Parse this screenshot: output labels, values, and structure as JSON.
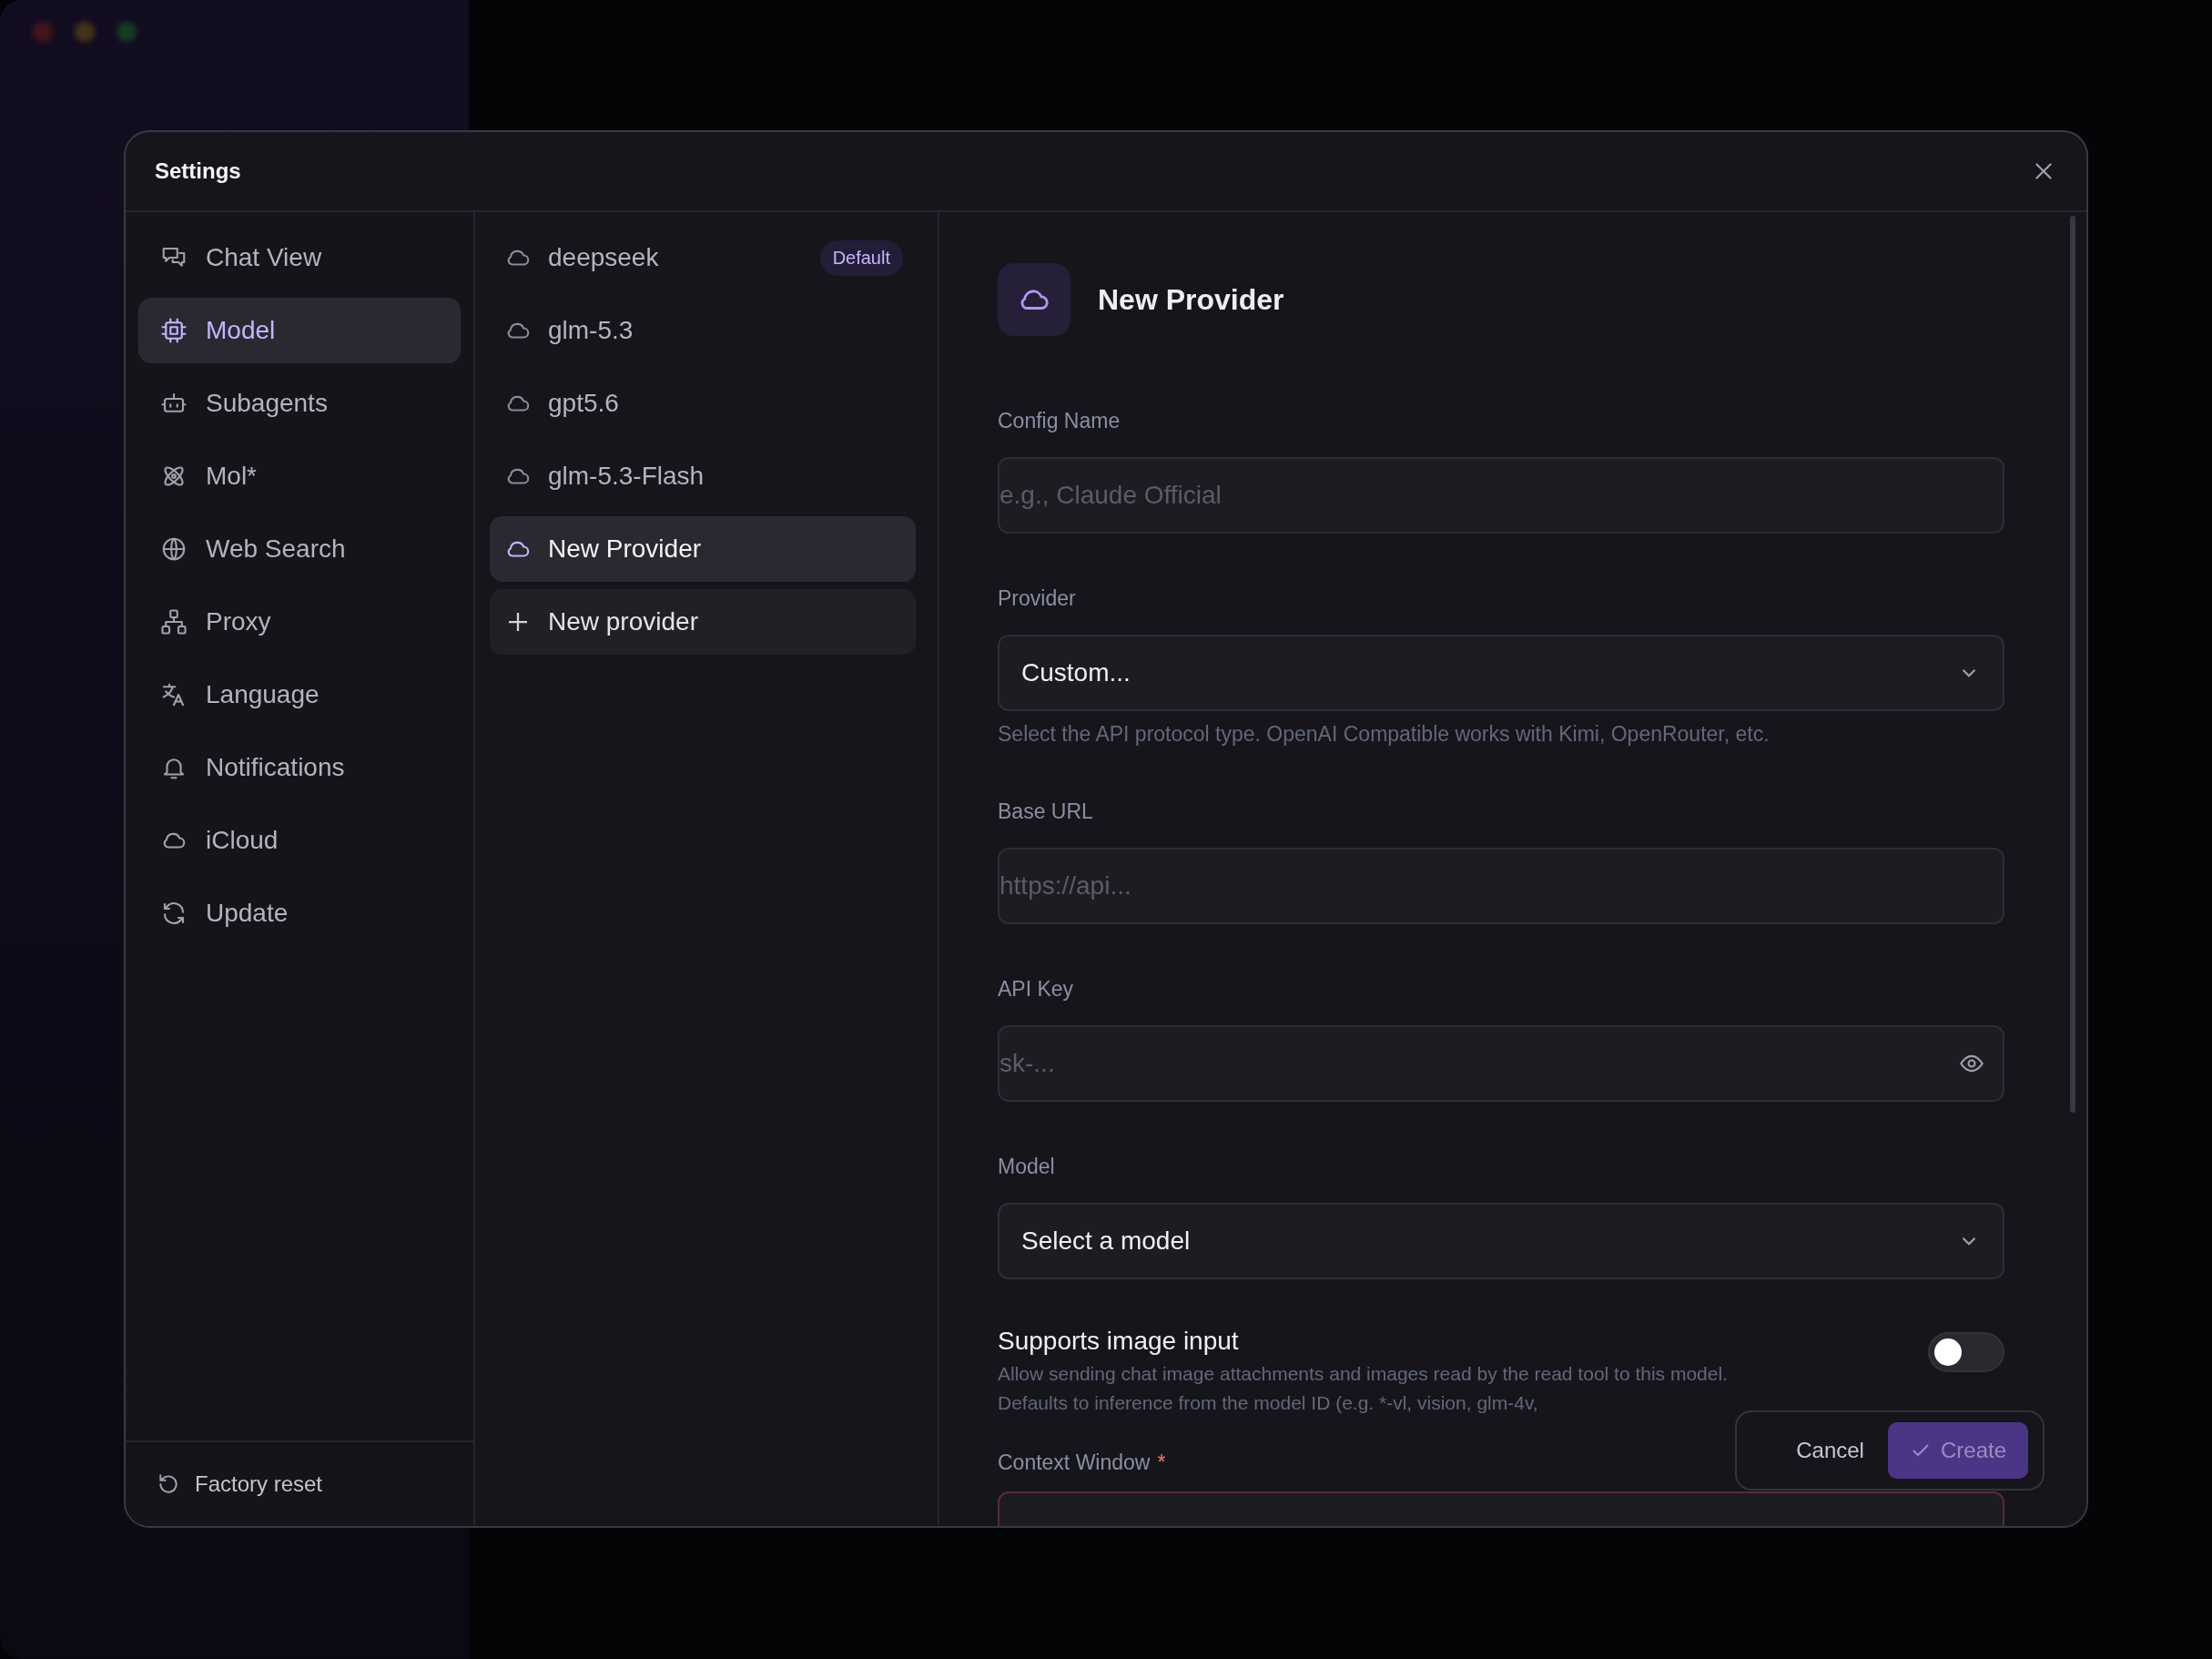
{
  "window": {
    "title": "Settings"
  },
  "nav": {
    "items": [
      {
        "label": "Chat View",
        "selected": false
      },
      {
        "label": "Model",
        "selected": true
      },
      {
        "label": "Subagents",
        "selected": false
      },
      {
        "label": "Mol*",
        "selected": false
      },
      {
        "label": "Web Search",
        "selected": false
      },
      {
        "label": "Proxy",
        "selected": false
      },
      {
        "label": "Language",
        "selected": false
      },
      {
        "label": "Notifications",
        "selected": false
      },
      {
        "label": "iCloud",
        "selected": false
      },
      {
        "label": "Update",
        "selected": false
      }
    ],
    "footer": "Factory reset"
  },
  "providers": {
    "items": [
      {
        "name": "deepseek",
        "badge": "Default",
        "selected": false
      },
      {
        "name": "glm-5.3",
        "selected": false
      },
      {
        "name": "gpt5.6",
        "selected": false
      },
      {
        "name": "glm-5.3-Flash",
        "selected": false
      },
      {
        "name": "New Provider",
        "selected": true
      }
    ],
    "add_label": "New provider"
  },
  "detail": {
    "title": "New Provider",
    "fields": [
      {
        "kind": "text",
        "label": "Config Name",
        "placeholder": "e.g., Claude Official"
      },
      {
        "kind": "select",
        "label": "Provider",
        "value": "Custom...",
        "hint": "Select the API protocol type. OpenAI Compatible works with Kimi, OpenRouter, etc."
      },
      {
        "kind": "text",
        "label": "Base URL",
        "placeholder": "https://api..."
      },
      {
        "kind": "secret",
        "label": "API Key",
        "placeholder": "sk-..."
      },
      {
        "kind": "select",
        "label": "Model",
        "value": "Select a model"
      }
    ],
    "toggle": {
      "label": "Supports image input",
      "description": "Allow sending chat image attachments and images read by the read tool to this model. Defaults to inference from the model ID (e.g. *-vl, vision, glm-4v,",
      "on": false
    },
    "context_window": {
      "label": "Context Window",
      "required": true,
      "mark": "*"
    }
  },
  "actions": {
    "cancel": "Cancel",
    "create": "Create",
    "create_disabled": true
  }
}
